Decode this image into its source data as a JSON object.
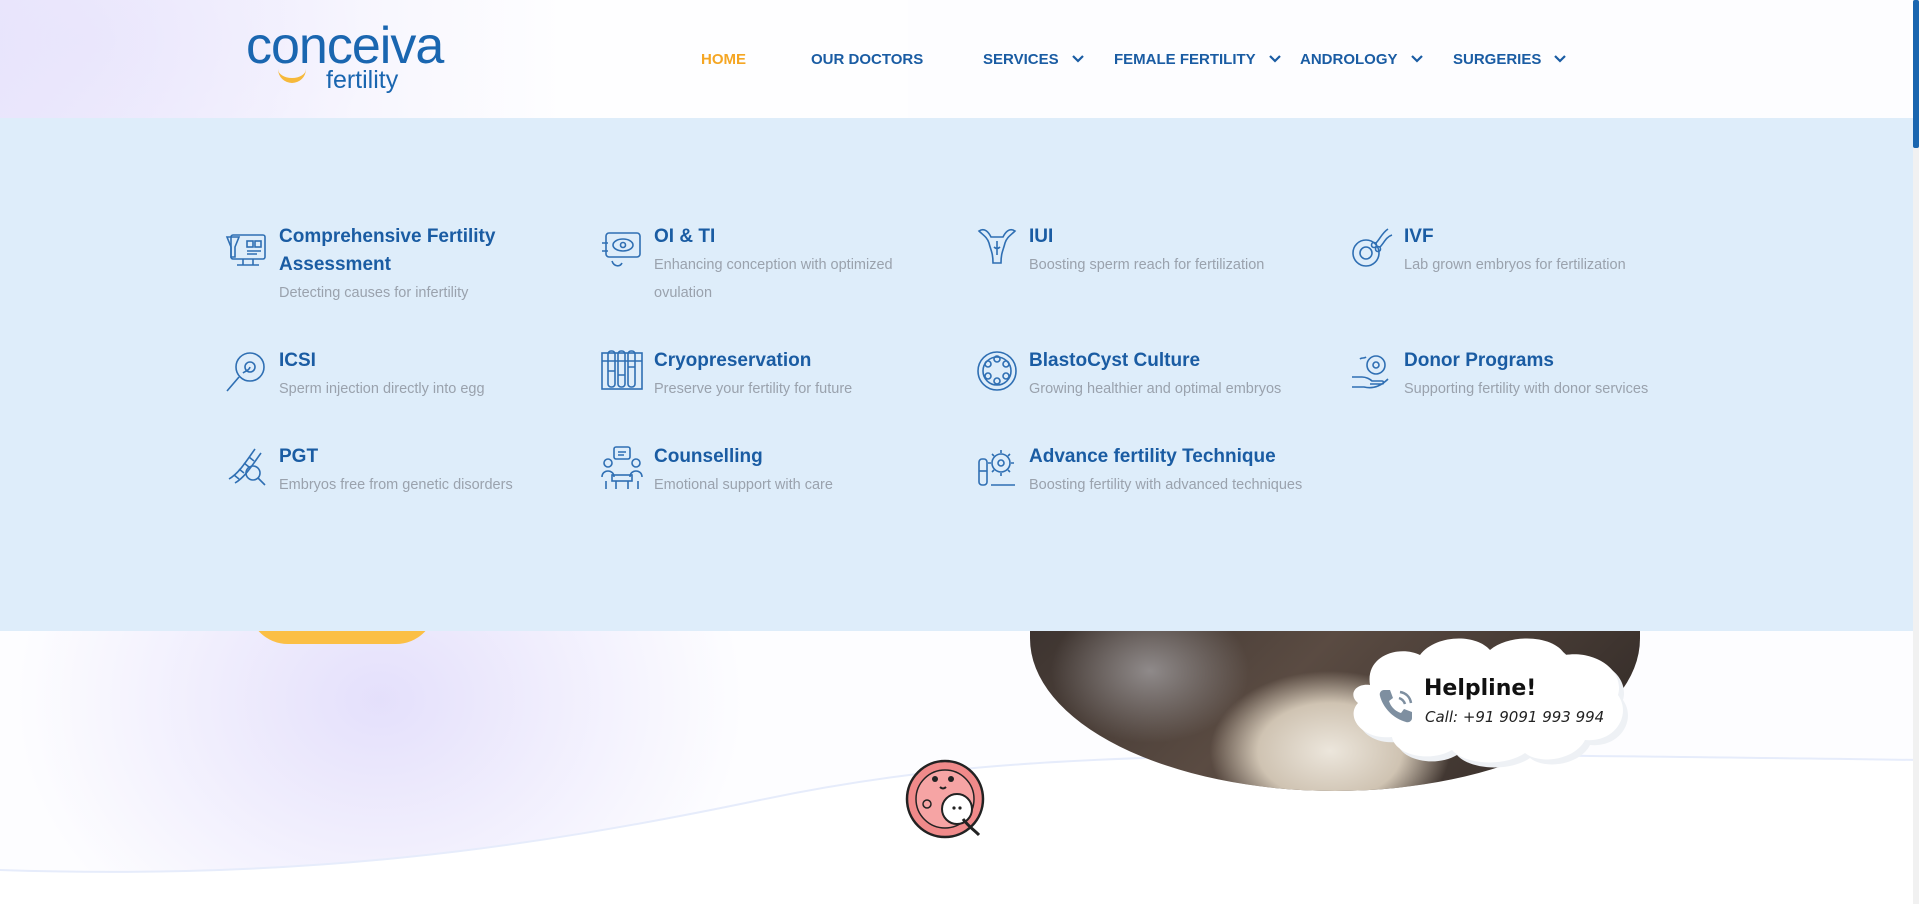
{
  "brand": {
    "name": "conceiva",
    "sub": "fertility",
    "color": "#1a66b0",
    "accent": "#f6b93b"
  },
  "nav": {
    "items": [
      {
        "label": "HOME",
        "active": true,
        "dropdown": false
      },
      {
        "label": "OUR DOCTORS",
        "active": false,
        "dropdown": false
      },
      {
        "label": "SERVICES",
        "active": false,
        "dropdown": true
      },
      {
        "label": "FEMALE FERTILITY",
        "active": false,
        "dropdown": true
      },
      {
        "label": "ANDROLOGY",
        "active": false,
        "dropdown": true
      },
      {
        "label": "SURGERIES",
        "active": false,
        "dropdown": true
      }
    ]
  },
  "services": [
    {
      "title": "Comprehensive Fertility Assessment",
      "desc": "Detecting causes for infertility",
      "icon": "assessment-icon"
    },
    {
      "title": "OI & TI",
      "desc": "Enhancing conception with optimized ovulation",
      "icon": "ovulation-monitor-icon"
    },
    {
      "title": "IUI",
      "desc": "Boosting sperm reach for fertilization",
      "icon": "uterus-icon"
    },
    {
      "title": "IVF",
      "desc": "Lab grown embryos for fertilization",
      "icon": "sperm-egg-icon"
    },
    {
      "title": "ICSI",
      "desc": "Sperm injection directly into egg",
      "icon": "injection-egg-icon"
    },
    {
      "title": "Cryopreservation",
      "desc": "Preserve your fertility for future",
      "icon": "test-tubes-icon"
    },
    {
      "title": "BlastoCyst Culture",
      "desc": "Growing healthier and optimal embryos",
      "icon": "blastocyst-icon"
    },
    {
      "title": "Donor Programs",
      "desc": "Supporting fertility with donor services",
      "icon": "donor-hand-icon"
    },
    {
      "title": "PGT",
      "desc": "Embryos free from genetic disorders",
      "icon": "dna-magnifier-icon"
    },
    {
      "title": "Counselling",
      "desc": "Emotional support with care",
      "icon": "counselling-icon"
    },
    {
      "title": "Advance fertility Technique",
      "desc": "Boosting fertility with advanced techniques",
      "icon": "gear-tube-icon"
    }
  ],
  "helpline": {
    "title": "Helpline!",
    "call": "Call: +91 9091 993 994"
  },
  "colors": {
    "menu_bg": "#deedfa",
    "title": "#1a5ca3",
    "desc": "#9aa2ad",
    "active_nav": "#f5a623",
    "cta": "#fbbf45"
  }
}
